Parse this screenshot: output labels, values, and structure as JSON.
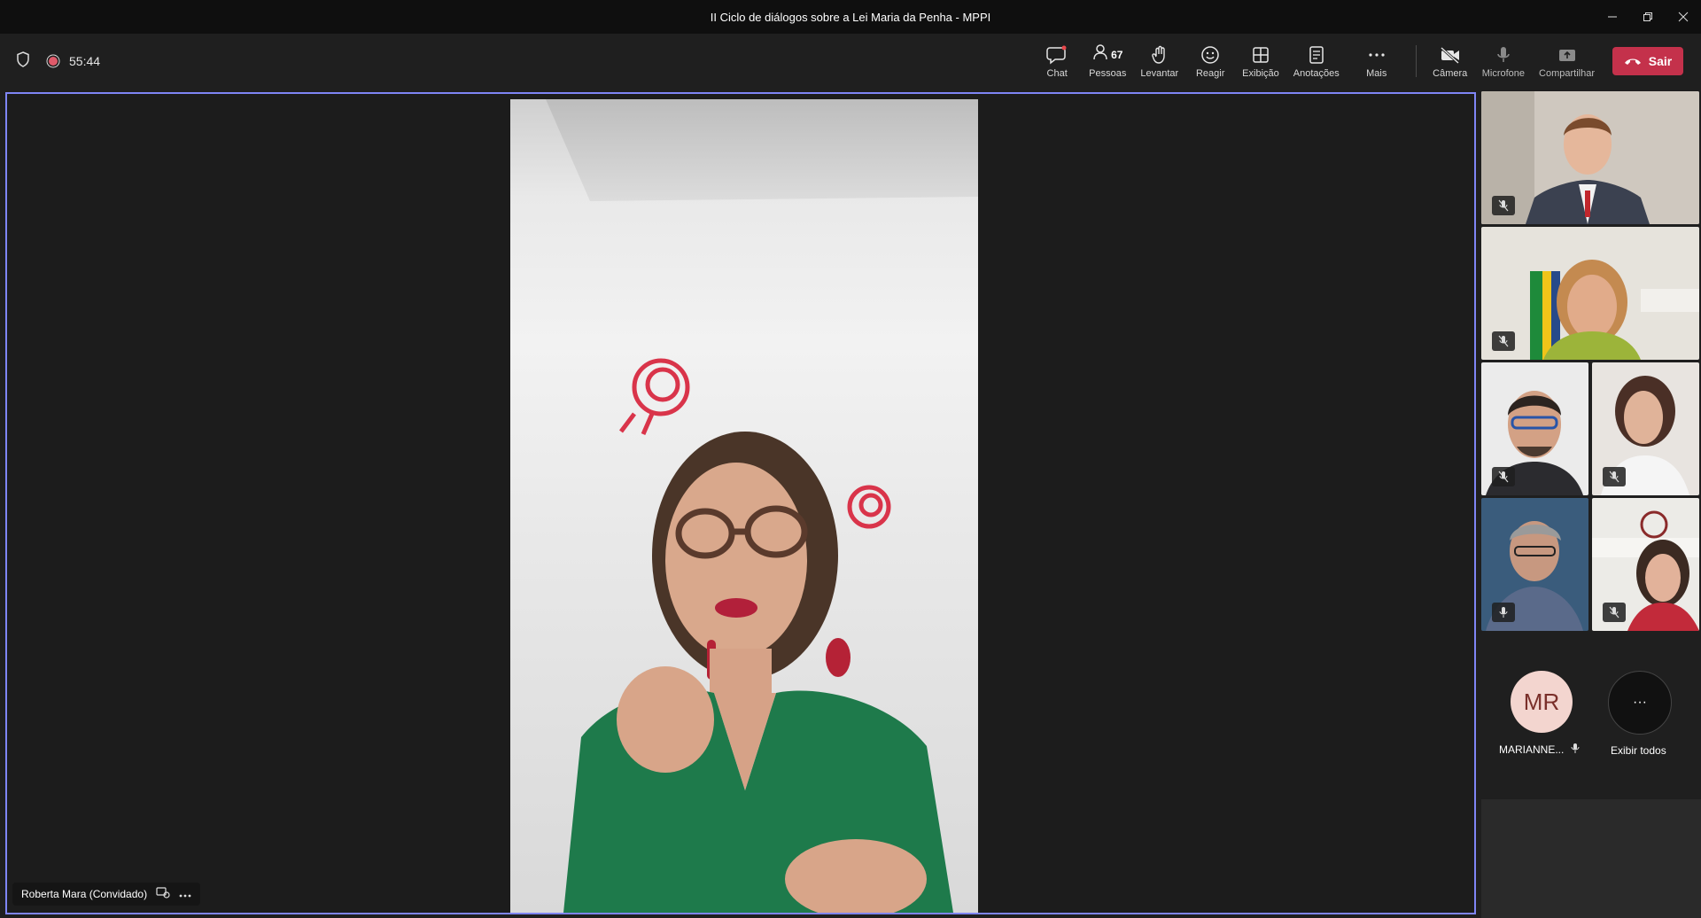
{
  "window": {
    "title": "II Ciclo de diálogos sobre a Lei Maria da Penha - MPPI"
  },
  "status": {
    "timer": "55:44",
    "recording_color": "#e05a6a"
  },
  "toolbar": {
    "chat_label": "Chat",
    "people_label": "Pessoas",
    "people_count": "67",
    "raise_label": "Levantar",
    "react_label": "Reagir",
    "view_label": "Exibição",
    "notes_label": "Anotações",
    "more_label": "Mais",
    "camera_label": "Câmera",
    "mic_label": "Microfone",
    "share_label": "Compartilhar",
    "leave_label": "Sair",
    "leave_color": "#c4314b"
  },
  "stage": {
    "speaker_name": "Roberta Mara (Convidado)"
  },
  "gallery": {
    "avatar_initials": "MR",
    "avatar_name": "MARIANNE...",
    "show_all_label": "Exibir todos",
    "show_all_icon": "···"
  }
}
